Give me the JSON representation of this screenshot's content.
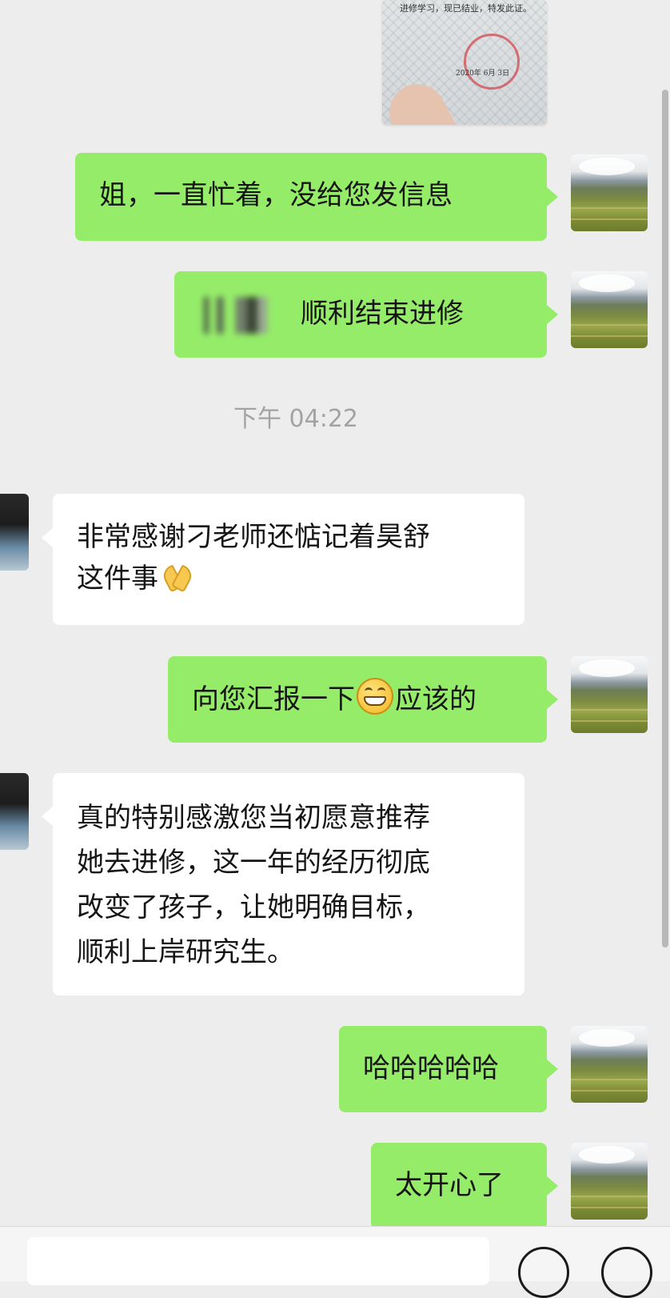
{
  "photo": {
    "cert_line": "进修学习，现已结业，特发此证。",
    "stamp_line": "2020年 6月 3日"
  },
  "messages": [
    {
      "side": "right",
      "text": "姐，一直忙着，没给您发信息"
    },
    {
      "side": "right",
      "text": "顺利结束进修",
      "has_blur_prefix": true
    },
    {
      "side": "left",
      "lines": [
        "非常感谢刁老师还惦记着昊舒",
        "这件事"
      ],
      "emoji_suffix": "folded-hands"
    },
    {
      "side": "right",
      "text_before": "向您汇报一下",
      "emoji": "grinning-face",
      "text_after": "应该的"
    },
    {
      "side": "left",
      "lines": [
        "真的特别感激您当初愿意推荐",
        "她去进修，这一年的经历彻底",
        "改变了孩子，让她明确目标，",
        "顺利上岸研究生。"
      ]
    },
    {
      "side": "right",
      "text": "哈哈哈哈哈"
    },
    {
      "side": "right",
      "text": "太开心了"
    }
  ],
  "timestamp": "下午 04:22",
  "icons": {
    "emoji_1": "grinning-face-icon",
    "emoji_2": "folded-hands-icon"
  },
  "colors": {
    "background": "#ededed",
    "sent_bubble": "#95ec69",
    "received_bubble": "#ffffff",
    "timestamp_text": "#a3a3a3"
  }
}
